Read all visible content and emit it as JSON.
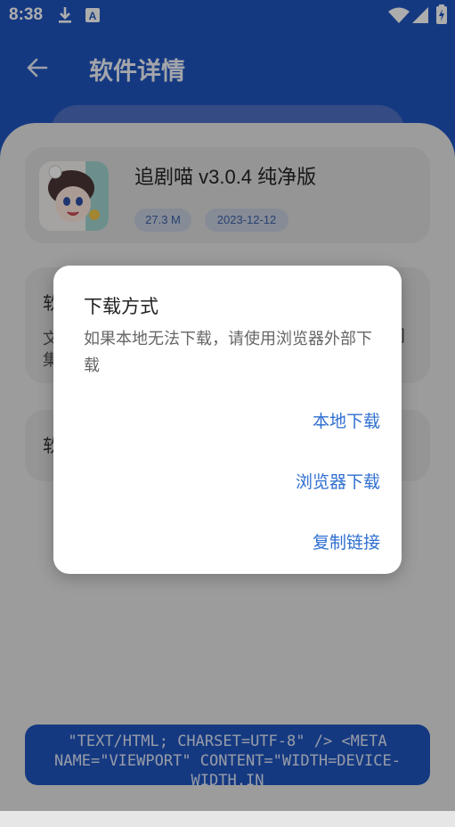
{
  "status_bar": {
    "time": "8:38",
    "icons": [
      "download-icon",
      "a-notification-icon",
      "wifi-icon",
      "signal-icon",
      "battery-charging-icon"
    ]
  },
  "app_bar": {
    "title": "软件详情",
    "back_icon": "arrow-back-icon"
  },
  "app_info": {
    "name": "追剧喵 v3.0.4 纯净版",
    "size": "27.3 M",
    "date": "2023-12-12"
  },
  "background_cards": {
    "card2_title_fragment": "软",
    "card2_line1_fragment": "文",
    "card2_line1_tail": "]",
    "card2_line2_fragment": "集",
    "card3_title_fragment": "软"
  },
  "dialog": {
    "title": "下载方式",
    "message": "如果本地无法下载，请使用浏览器外部下载",
    "actions": [
      "本地下载",
      "浏览器下载",
      "复制链接"
    ]
  },
  "bottom_button": {
    "text": "\"TEXT/HTML; CHARSET=UTF-8\" /> <META NAME=\"VIEWPORT\" CONTENT=\"WIDTH=DEVICE-WIDTH,IN"
  },
  "colors": {
    "primary": "#1f55bf",
    "accent_text": "#2f6fd0"
  }
}
